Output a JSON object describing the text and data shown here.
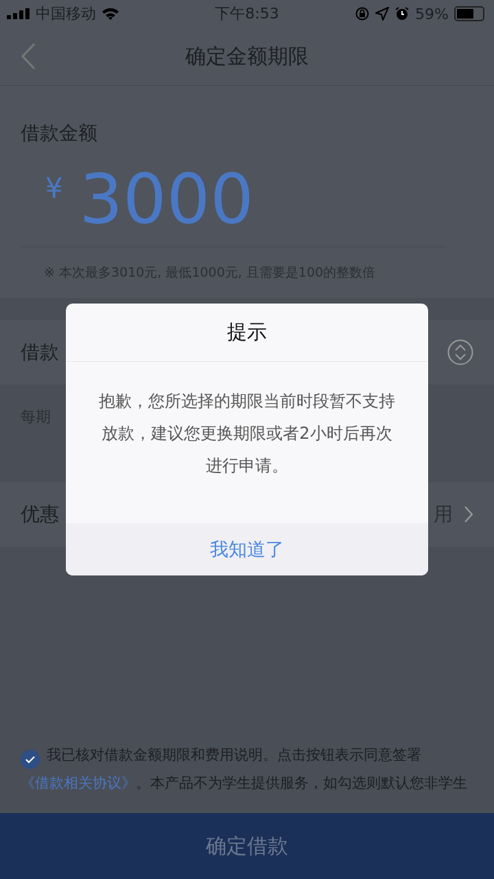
{
  "status_bar": {
    "carrier": "中国移动",
    "time": "下午8:53",
    "battery": "59%"
  },
  "nav": {
    "title": "确定金额期限"
  },
  "amount": {
    "label": "借款金额",
    "currency": "¥",
    "value": "3000",
    "hint": "※ 本次最多3010元, 最低1000元, 且需要是100的整数倍"
  },
  "rows": [
    {
      "kind": "term",
      "label": "借款"
    },
    {
      "kind": "plain",
      "label": "每期"
    },
    {
      "kind": "coupon",
      "label": "优惠",
      "value": "用"
    }
  ],
  "agreement": {
    "checked": true,
    "text_before": "我已核对借款金额期限和费用说明。点击按钮表示同意签署",
    "link": "《借款相关协议》",
    "text_after": "。本产品不为学生提供服务，如勾选则默认您非学生"
  },
  "submit_button": "确定借款",
  "dialog": {
    "title": "提示",
    "message": "抱歉，您所选择的期限当前时段暂不支持放款，建议您更换期限或者2小时后再次进行申请。",
    "button": "我知道了"
  }
}
